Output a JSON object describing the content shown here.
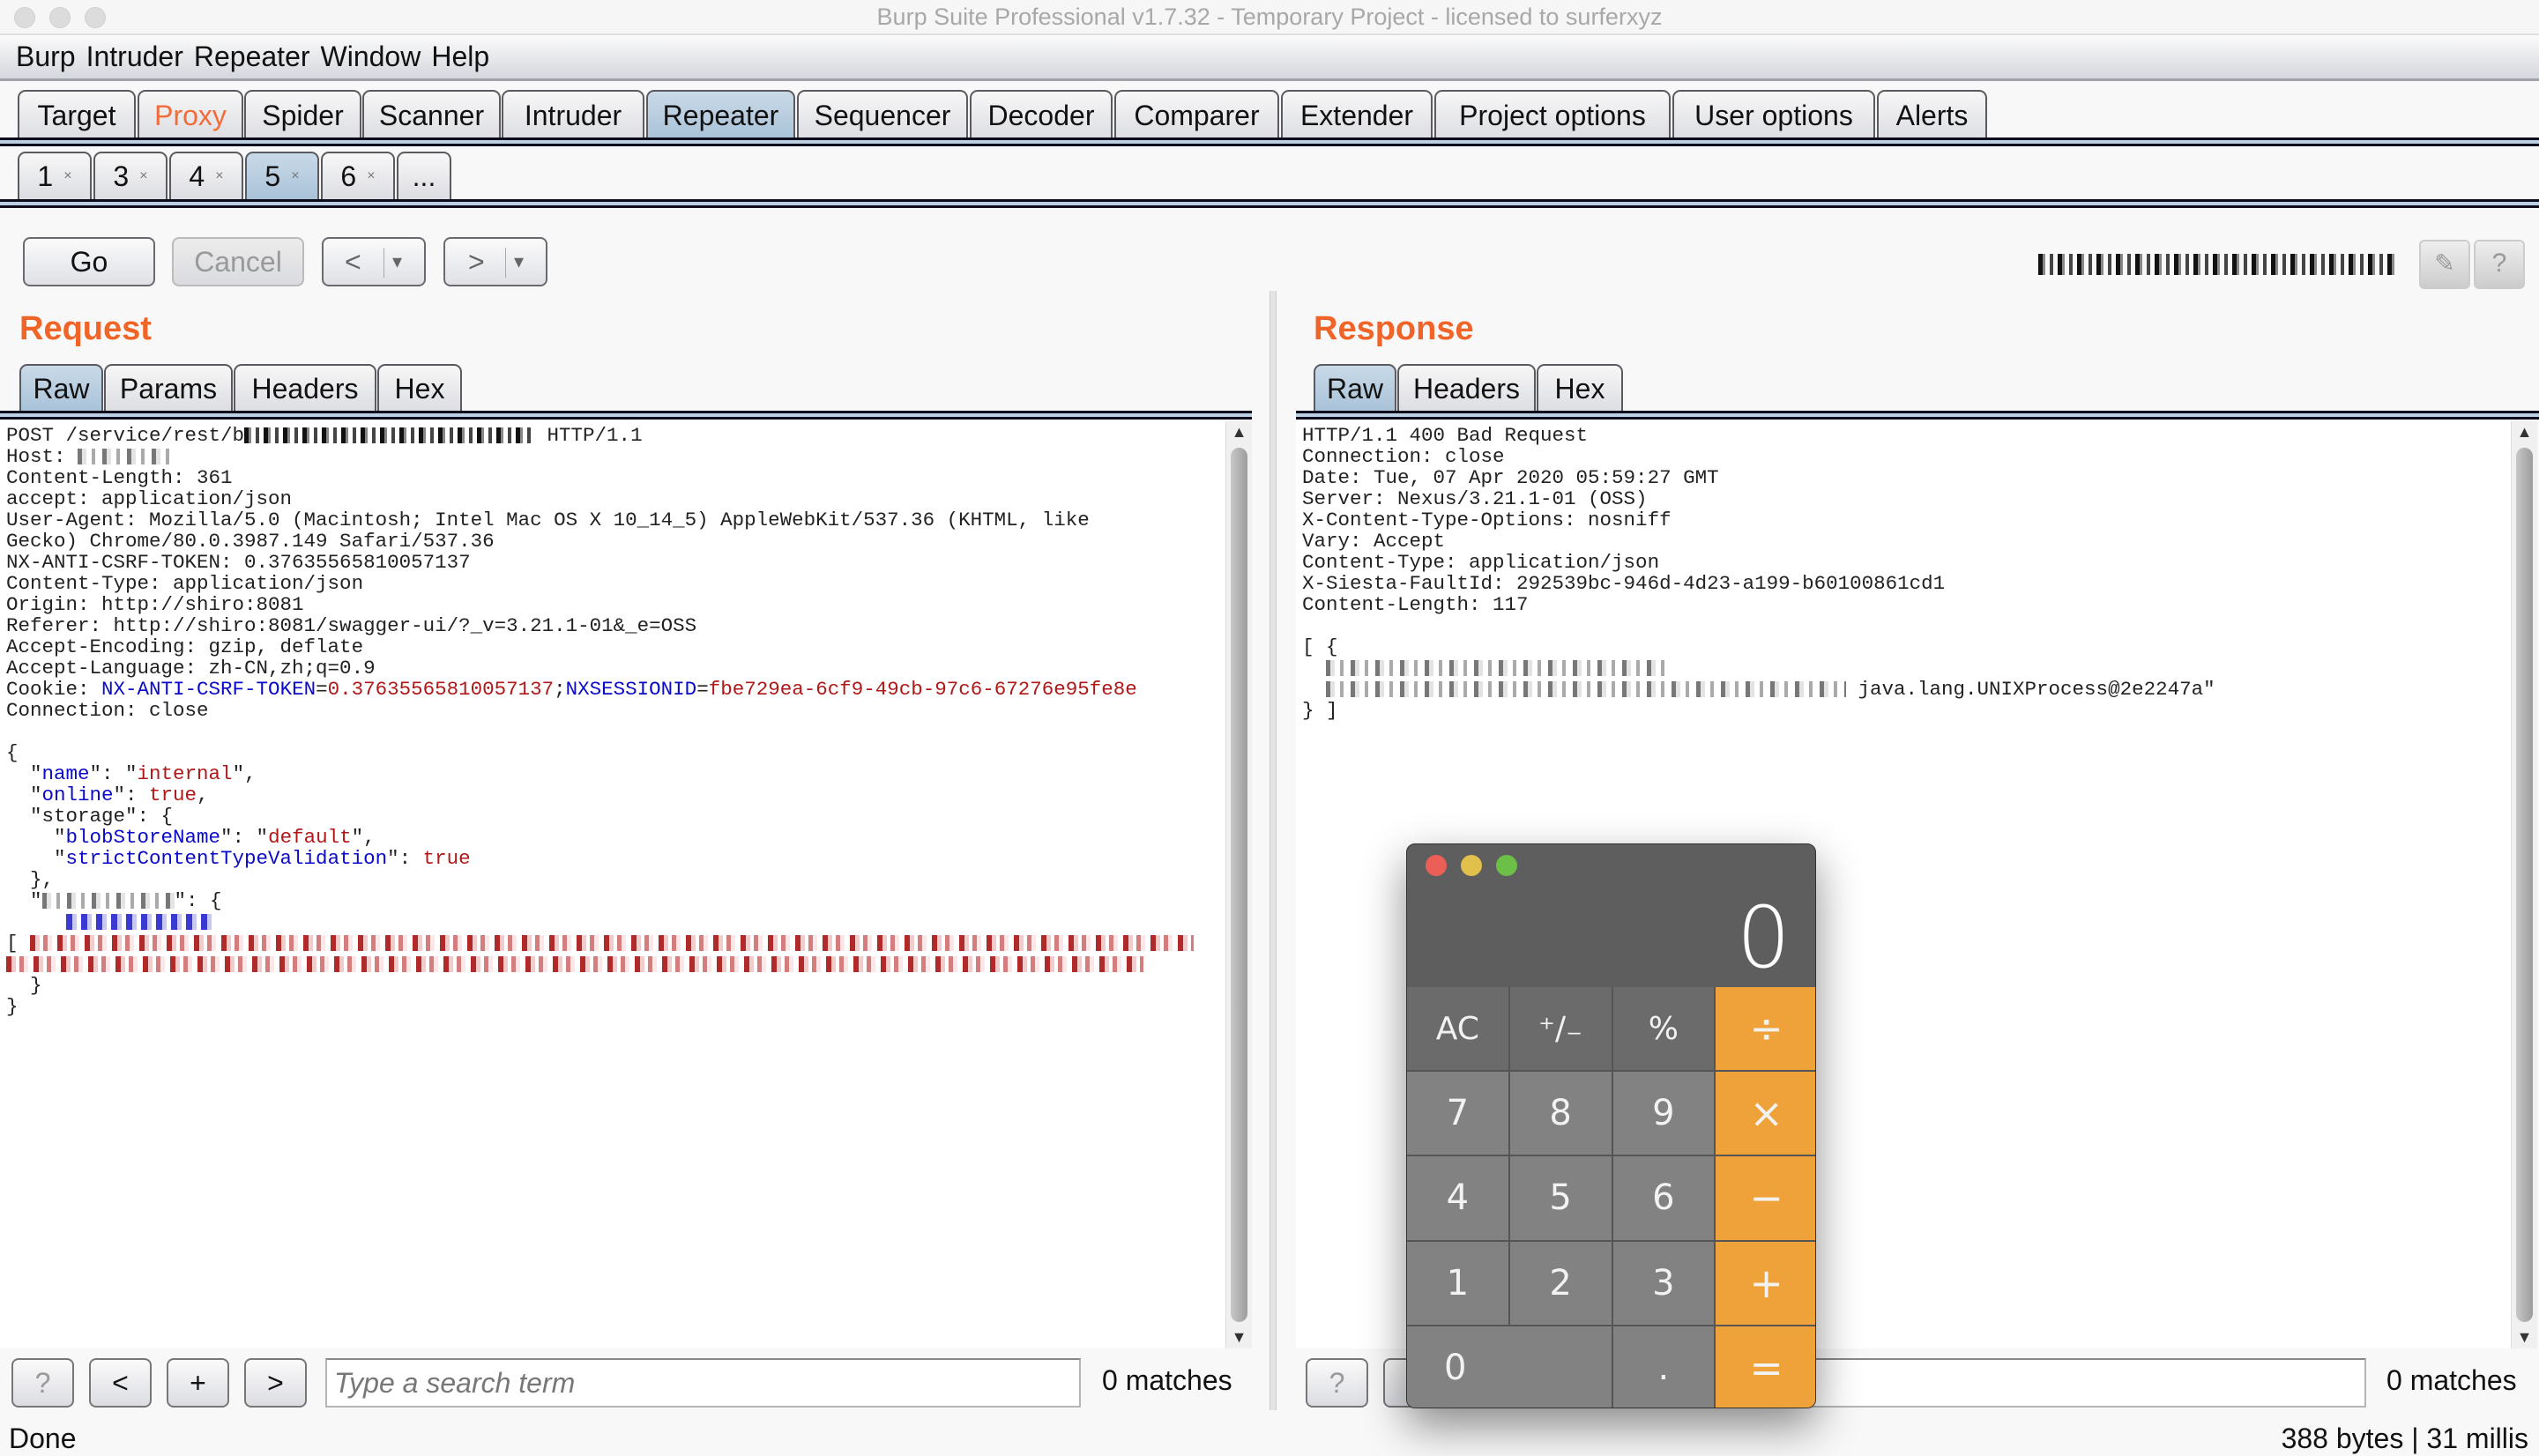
{
  "window": {
    "title": "Burp Suite Professional v1.7.32 - Temporary Project - licensed to surferxyz"
  },
  "menu": [
    "Burp",
    "Intruder",
    "Repeater",
    "Window",
    "Help"
  ],
  "main_tabs": [
    {
      "label": "Target"
    },
    {
      "label": "Proxy",
      "highlight": "#f26c3a"
    },
    {
      "label": "Spider"
    },
    {
      "label": "Scanner"
    },
    {
      "label": "Intruder"
    },
    {
      "label": "Repeater",
      "selected": true
    },
    {
      "label": "Sequencer"
    },
    {
      "label": "Decoder"
    },
    {
      "label": "Comparer"
    },
    {
      "label": "Extender"
    },
    {
      "label": "Project options"
    },
    {
      "label": "User options"
    },
    {
      "label": "Alerts"
    }
  ],
  "repeater_tabs": [
    {
      "label": "1",
      "close": "×"
    },
    {
      "label": "3",
      "close": "×"
    },
    {
      "label": "4",
      "close": "×"
    },
    {
      "label": "5",
      "close": "×",
      "selected": true
    },
    {
      "label": "6",
      "close": "×"
    },
    {
      "label": "..."
    }
  ],
  "toolbar": {
    "go": "Go",
    "cancel": "Cancel",
    "back": "<",
    "forward": ">",
    "dropdown": "▾"
  },
  "request": {
    "heading": "Request",
    "tabs": [
      "Raw",
      "Params",
      "Headers",
      "Hex"
    ],
    "selected_tab": "Raw",
    "lines": [
      [
        [
          "POST /service/rest/b",
          ""
        ],
        {
          "redacted": "black"
        },
        [
          " HTTP/1.1",
          ""
        ]
      ],
      [
        [
          "Host: ",
          ""
        ],
        {
          "redacted": "gray"
        }
      ],
      [
        [
          "Content-Length: 361",
          ""
        ]
      ],
      [
        [
          "accept: application/json",
          ""
        ]
      ],
      [
        [
          "User-Agent: Mozilla/5.0 (Macintosh; Intel Mac OS X 10_14_5) AppleWebKit/537.36 (KHTML, like",
          ""
        ]
      ],
      [
        [
          "Gecko) Chrome/80.0.3987.149 Safari/537.36",
          ""
        ]
      ],
      [
        [
          "NX-ANTI-CSRF-TOKEN: 0.37635565810057137",
          ""
        ]
      ],
      [
        [
          "Content-Type: application/json",
          ""
        ]
      ],
      [
        [
          "Origin: http://shiro:8081",
          ""
        ]
      ],
      [
        [
          "Referer: http://shiro:8081/swagger-ui/?_v=3.21.1-01&_e=OSS",
          ""
        ]
      ],
      [
        [
          "Accept-Encoding: gzip, deflate",
          ""
        ]
      ],
      [
        [
          "Accept-Language: zh-CN,zh;q=0.9",
          ""
        ]
      ],
      [
        [
          "Cookie: ",
          ""
        ],
        [
          "NX-ANTI-CSRF-TOKEN",
          "k"
        ],
        [
          "=",
          ""
        ],
        [
          "0.37635565810057137",
          "v"
        ],
        [
          ";",
          ""
        ],
        [
          "NXSESSIONID",
          "k"
        ],
        [
          "=",
          ""
        ],
        [
          "fbe729ea-6cf9-49cb-97c6-67276e95fe8e",
          "v"
        ]
      ],
      [
        [
          "Connection: close",
          ""
        ]
      ],
      [],
      [
        [
          "{",
          ""
        ]
      ],
      [
        [
          "  \"",
          ""
        ],
        [
          "name",
          "k"
        ],
        [
          "\": \"",
          ""
        ],
        [
          "internal",
          "v"
        ],
        [
          "\",",
          ""
        ]
      ],
      [
        [
          "  \"",
          ""
        ],
        [
          "online",
          "k"
        ],
        [
          "\": ",
          ""
        ],
        [
          "true",
          "v"
        ],
        [
          ",",
          ""
        ]
      ],
      [
        [
          "  \"storage\": {",
          ""
        ]
      ],
      [
        [
          "    \"",
          ""
        ],
        [
          "blobStoreName",
          "k"
        ],
        [
          "\": \"",
          ""
        ],
        [
          "default",
          "v"
        ],
        [
          "\",",
          ""
        ]
      ],
      [
        [
          "    \"",
          ""
        ],
        [
          "strictContentTypeValidation",
          "k"
        ],
        [
          "\": ",
          ""
        ],
        [
          "true",
          "v"
        ]
      ],
      [
        [
          "  },",
          ""
        ]
      ],
      [
        [
          "  \"",
          ""
        ],
        {
          "redacted": "gray"
        },
        [
          "\": {",
          ""
        ]
      ],
      [
        [
          "     ",
          ""
        ],
        {
          "redacted": "blue"
        }
      ],
      [
        [
          "[ ",
          ""
        ],
        {
          "redacted": "red"
        }
      ],
      [
        {
          "redacted": "red"
        }
      ],
      [
        [
          "  }",
          ""
        ]
      ],
      [
        [
          "}",
          ""
        ]
      ]
    ],
    "search": {
      "help": "?",
      "prev": "<",
      "add": "+",
      "next": ">",
      "placeholder": "Type a search term",
      "matches": "0 matches"
    }
  },
  "response": {
    "heading": "Response",
    "tabs": [
      "Raw",
      "Headers",
      "Hex"
    ],
    "selected_tab": "Raw",
    "lines": [
      [
        [
          "HTTP/1.1 400 Bad Request",
          ""
        ]
      ],
      [
        [
          "Connection: close",
          ""
        ]
      ],
      [
        [
          "Date: Tue, 07 Apr 2020 05:59:27 GMT",
          ""
        ]
      ],
      [
        [
          "Server: Nexus/3.21.1-01 (OSS)",
          ""
        ]
      ],
      [
        [
          "X-Content-Type-Options: nosniff",
          ""
        ]
      ],
      [
        [
          "Vary: Accept",
          ""
        ]
      ],
      [
        [
          "Content-Type: application/json",
          ""
        ]
      ],
      [
        [
          "X-Siesta-FaultId: 292539bc-946d-4d23-a199-b60100861cd1",
          ""
        ]
      ],
      [
        [
          "Content-Length: 117",
          ""
        ]
      ],
      [],
      [
        [
          "[ {",
          ""
        ]
      ],
      [
        [
          "  ",
          ""
        ],
        {
          "redacted": "gray"
        }
      ],
      [
        [
          "  ",
          ""
        ],
        {
          "redacted": "gray"
        },
        [
          " java.lang.UNIXProcess@2e2247a\"",
          ""
        ]
      ],
      [
        [
          "} ]",
          ""
        ]
      ]
    ],
    "search": {
      "help": "?",
      "placeholder": "Type a search term",
      "visible_placeholder_fragment": "term",
      "matches": "0 matches"
    }
  },
  "status": {
    "left": "Done",
    "right": "388 bytes | 31 millis"
  },
  "calculator": {
    "display": "0",
    "keys": [
      {
        "label": "AC",
        "type": "fn"
      },
      {
        "label": "⁺∕₋",
        "type": "fn"
      },
      {
        "label": "%",
        "type": "fn"
      },
      {
        "label": "÷",
        "type": "op"
      },
      {
        "label": "7"
      },
      {
        "label": "8"
      },
      {
        "label": "9"
      },
      {
        "label": "×",
        "type": "op"
      },
      {
        "label": "4"
      },
      {
        "label": "5"
      },
      {
        "label": "6"
      },
      {
        "label": "−",
        "type": "op"
      },
      {
        "label": "1"
      },
      {
        "label": "2"
      },
      {
        "label": "3"
      },
      {
        "label": "+",
        "type": "op"
      },
      {
        "label": "0",
        "type": "zero"
      },
      {
        "label": ".",
        "type": ""
      },
      {
        "label": "=",
        "type": "op"
      }
    ],
    "colors": {
      "operator": "#f0a23a",
      "close": "#ec5f57",
      "minimize": "#e1c04c",
      "zoom": "#6cbf47"
    }
  },
  "colors": {
    "accent_orange": "#f06428",
    "selected_tab": "#b8cde0",
    "json_key": "#0a0ac8",
    "json_value": "#b01818"
  }
}
